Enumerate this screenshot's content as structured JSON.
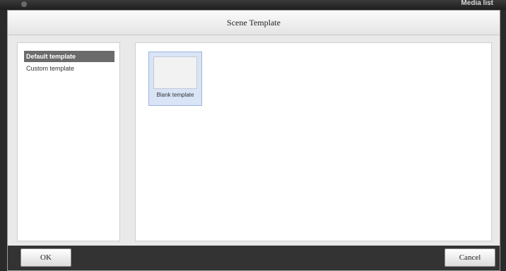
{
  "background": {
    "label": "Media list"
  },
  "dialog": {
    "title": "Scene Template",
    "categories": [
      {
        "label": "Default template",
        "selected": true
      },
      {
        "label": "Custom template",
        "selected": false
      }
    ],
    "templates": [
      {
        "label": "Blank template",
        "selected": true
      }
    ],
    "ok_label": "OK",
    "cancel_label": "Cancel"
  },
  "colors": {
    "selected_item": "#6b6b6b",
    "tile_selected": "#d9e4f6",
    "footer": "#333333"
  }
}
